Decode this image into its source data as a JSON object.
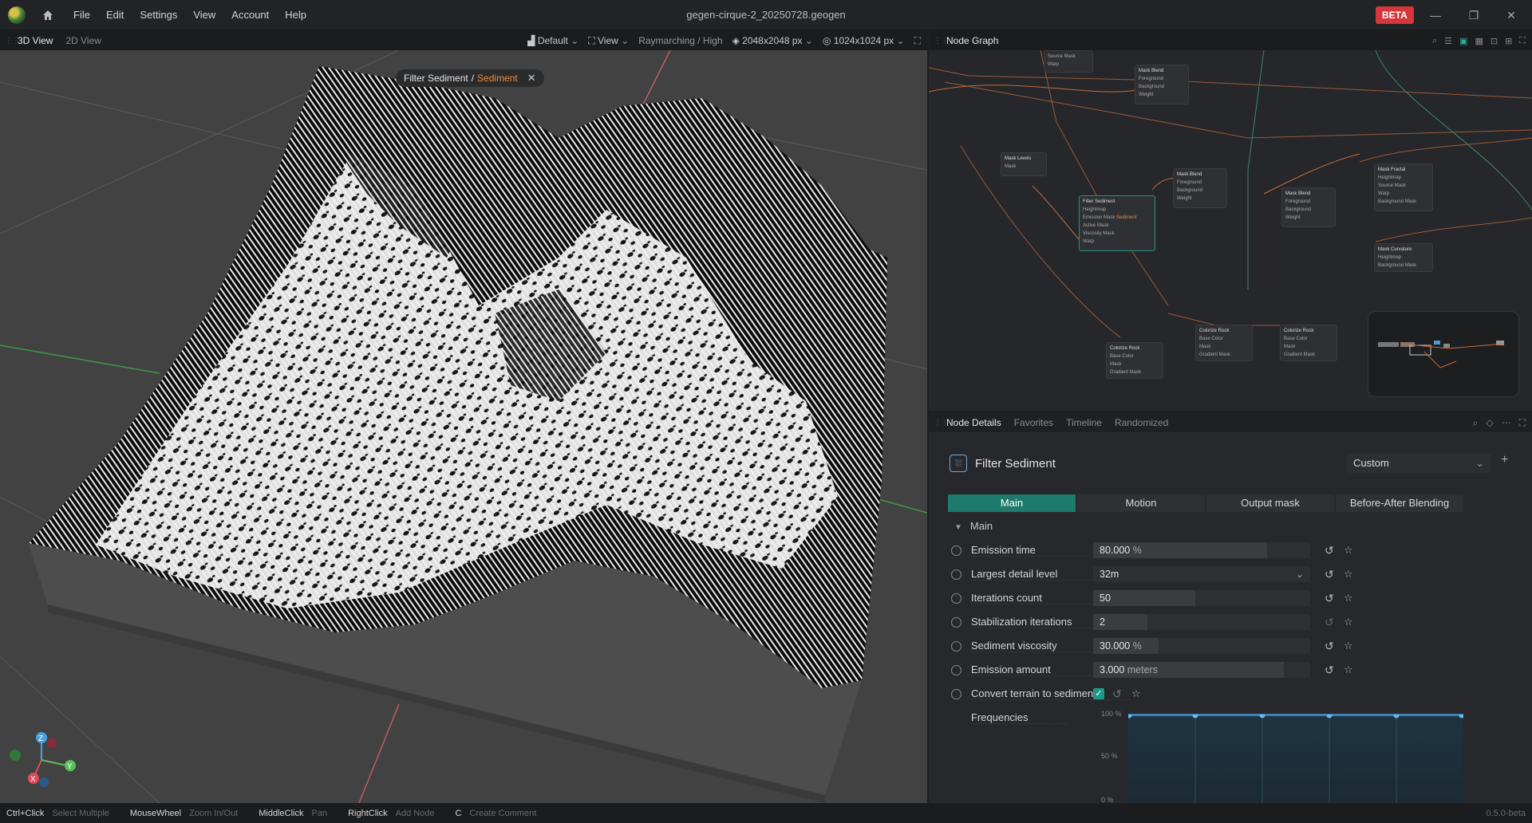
{
  "titlebar": {
    "menu": [
      "File",
      "Edit",
      "Settings",
      "View",
      "Account",
      "Help"
    ],
    "title": "gegen-cirque-2_20250728.geogen",
    "beta": "BETA"
  },
  "left_panel": {
    "tabs": [
      "3D View",
      "2D View"
    ],
    "toolbar": {
      "camera": "Default",
      "view": "View",
      "render": "Raymarching / High",
      "resolution": "2048x2048 px",
      "preview": "1024x1024 px"
    },
    "breadcrumb": {
      "node": "Filter Sediment",
      "sep": "/",
      "output": "Sediment"
    },
    "axes": {
      "z": "Z",
      "y": "Y",
      "x": "X"
    }
  },
  "node_graph": {
    "title": "Node Graph",
    "nodes": [
      {
        "title": "Mask Blend",
        "ports": [
          "Foreground",
          "Background",
          "Weight"
        ]
      },
      {
        "title": "Mask Levels",
        "ports": [
          "Mask"
        ]
      },
      {
        "title": "Filter Sediment",
        "ports": [
          "Heightmap",
          "Emission Mask",
          "Active Mask",
          "Viscosity Mask",
          "Warp"
        ]
      },
      {
        "title": "Mask Blend",
        "ports": [
          "Foreground",
          "Background",
          "Weight"
        ]
      },
      {
        "title": "Mask Blend",
        "ports": [
          "Foreground",
          "Background",
          "Weight"
        ]
      },
      {
        "title": "Mask Fractal",
        "ports": [
          "Heightmap",
          "Source Mask",
          "Warp",
          "Background Mask"
        ]
      },
      {
        "title": "Mask Curvature",
        "ports": [
          "Heightmap",
          "Background Mask"
        ]
      },
      {
        "title": "Colorize Rock",
        "ports": [
          "Base Color",
          "Mask",
          "Gradient Mask"
        ]
      },
      {
        "title": "Colorize Rock",
        "ports": [
          "Base Color",
          "Mask",
          "Gradient Mask"
        ]
      },
      {
        "title": "Colorize Rock",
        "ports": [
          "Base Color",
          "Mask",
          "Gradient Mask"
        ]
      }
    ]
  },
  "details": {
    "tabs": [
      "Node Details",
      "Favorites",
      "Timeline",
      "Randomized"
    ],
    "node_title": "Filter Sediment",
    "preset": "Custom",
    "subtabs": [
      "Main",
      "Motion",
      "Output mask",
      "Before-After Blending"
    ],
    "section": "Main",
    "params": [
      {
        "label": "Emission time",
        "value": "80.000",
        "unit": "%",
        "fill": 0.8
      },
      {
        "label": "Largest detail level",
        "value": "32m",
        "unit": "",
        "fill": 0
      },
      {
        "label": "Iterations count",
        "value": "50",
        "unit": "",
        "fill": 0.47
      },
      {
        "label": "Stabilization iterations",
        "value": "2",
        "unit": "",
        "fill": 0.25
      },
      {
        "label": "Sediment viscosity",
        "value": "30.000",
        "unit": "%",
        "fill": 0.3
      },
      {
        "label": "Emission amount",
        "value": "3.000",
        "unit": "meters",
        "fill": 0.88
      }
    ],
    "convert_label": "Convert terrain to sediment",
    "frequencies_label": "Frequencies",
    "freq_axis": [
      "100 %",
      "50 %",
      "0 %"
    ]
  },
  "statusbar": [
    {
      "key": "Ctrl+Click",
      "desc": "Select Multiple"
    },
    {
      "key": "MouseWheel",
      "desc": "Zoom In/Out"
    },
    {
      "key": "MiddleClick",
      "desc": "Pan"
    },
    {
      "key": "RightClick",
      "desc": "Add Node"
    },
    {
      "key": "C",
      "desc": "Create Comment"
    }
  ],
  "version": "0.5.0-beta"
}
